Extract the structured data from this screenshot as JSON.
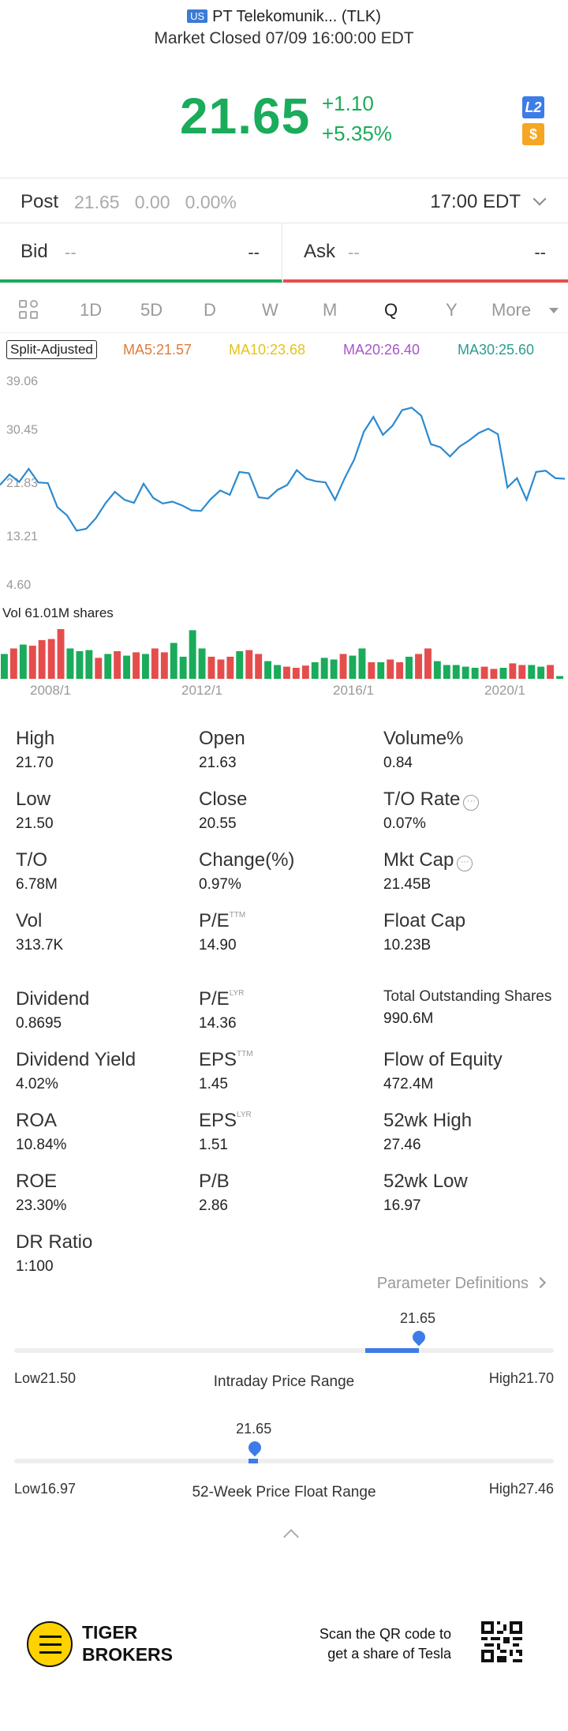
{
  "header": {
    "market_badge": "US",
    "title": "PT Telekomunik... (TLK)",
    "status": "Market Closed 07/09 16:00:00 EDT"
  },
  "quote": {
    "price": "21.65",
    "change": "+1.10",
    "change_pct": "+5.35%",
    "badge_l2": "L2",
    "badge_dollar": "$",
    "up_color": "#1aab5b"
  },
  "post": {
    "label": "Post",
    "values": "21.65   0.00   0.00%",
    "time": "17:00 EDT"
  },
  "bid": {
    "label": "Bid",
    "price": "--",
    "size": "--"
  },
  "ask": {
    "label": "Ask",
    "price": "--",
    "size": "--"
  },
  "tabs": [
    "1D",
    "5D",
    "D",
    "W",
    "M",
    "Q",
    "Y",
    "More"
  ],
  "active_tab": "Q",
  "ma": {
    "split": "Split-Adjusted",
    "ma5": "MA5:21.57",
    "ma10": "MA10:23.68",
    "ma20": "MA20:26.40",
    "ma30": "MA30:25.60"
  },
  "chart_data": {
    "type": "line",
    "y_ticks": [
      "39.06",
      "30.45",
      "21.83",
      "13.21",
      "4.60"
    ],
    "ylim": [
      4.6,
      39.06
    ],
    "x_labels": [
      "2008/1",
      "2012/1",
      "2016/1",
      "2020/1"
    ],
    "volume_label": "Vol",
    "volume_value": "61.01M shares",
    "series": [
      {
        "values": [
          21.4,
          23.1,
          21.9,
          24.0,
          21.8,
          21.7,
          17.8,
          16.5,
          14.0,
          14.3,
          16.0,
          18.4,
          20.3,
          19.0,
          18.5,
          21.6,
          19.3,
          18.4,
          18.7,
          18.1,
          17.3,
          17.2,
          19.1,
          20.5,
          19.8,
          23.5,
          23.3,
          19.4,
          19.2,
          20.6,
          21.4,
          23.8,
          22.4,
          22.0,
          21.8,
          19.0,
          22.5,
          25.5,
          30.0,
          32.4,
          29.5,
          31.0,
          33.5,
          33.9,
          32.6,
          28.0,
          27.5,
          26.0,
          27.6,
          28.6,
          29.8,
          30.5,
          29.6,
          21.0,
          22.5,
          19.0,
          23.5,
          23.7,
          22.5,
          22.4
        ]
      }
    ],
    "volume": [
      {
        "v": 0.45,
        "up": true
      },
      {
        "v": 0.55,
        "up": false
      },
      {
        "v": 0.62,
        "up": true
      },
      {
        "v": 0.6,
        "up": false
      },
      {
        "v": 0.7,
        "up": false
      },
      {
        "v": 0.72,
        "up": false
      },
      {
        "v": 0.9,
        "up": false
      },
      {
        "v": 0.55,
        "up": true
      },
      {
        "v": 0.5,
        "up": true
      },
      {
        "v": 0.52,
        "up": true
      },
      {
        "v": 0.38,
        "up": false
      },
      {
        "v": 0.45,
        "up": true
      },
      {
        "v": 0.5,
        "up": false
      },
      {
        "v": 0.42,
        "up": true
      },
      {
        "v": 0.48,
        "up": false
      },
      {
        "v": 0.45,
        "up": true
      },
      {
        "v": 0.55,
        "up": false
      },
      {
        "v": 0.48,
        "up": false
      },
      {
        "v": 0.65,
        "up": true
      },
      {
        "v": 0.4,
        "up": true
      },
      {
        "v": 0.88,
        "up": true
      },
      {
        "v": 0.55,
        "up": true
      },
      {
        "v": 0.4,
        "up": false
      },
      {
        "v": 0.35,
        "up": false
      },
      {
        "v": 0.4,
        "up": false
      },
      {
        "v": 0.5,
        "up": true
      },
      {
        "v": 0.52,
        "up": false
      },
      {
        "v": 0.45,
        "up": false
      },
      {
        "v": 0.32,
        "up": true
      },
      {
        "v": 0.25,
        "up": true
      },
      {
        "v": 0.22,
        "up": false
      },
      {
        "v": 0.2,
        "up": false
      },
      {
        "v": 0.24,
        "up": false
      },
      {
        "v": 0.3,
        "up": true
      },
      {
        "v": 0.38,
        "up": true
      },
      {
        "v": 0.35,
        "up": true
      },
      {
        "v": 0.45,
        "up": false
      },
      {
        "v": 0.42,
        "up": true
      },
      {
        "v": 0.55,
        "up": true
      },
      {
        "v": 0.3,
        "up": false
      },
      {
        "v": 0.3,
        "up": true
      },
      {
        "v": 0.35,
        "up": false
      },
      {
        "v": 0.3,
        "up": false
      },
      {
        "v": 0.4,
        "up": true
      },
      {
        "v": 0.45,
        "up": false
      },
      {
        "v": 0.55,
        "up": false
      },
      {
        "v": 0.32,
        "up": true
      },
      {
        "v": 0.25,
        "up": true
      },
      {
        "v": 0.25,
        "up": true
      },
      {
        "v": 0.22,
        "up": true
      },
      {
        "v": 0.2,
        "up": true
      },
      {
        "v": 0.22,
        "up": false
      },
      {
        "v": 0.18,
        "up": false
      },
      {
        "v": 0.2,
        "up": true
      },
      {
        "v": 0.28,
        "up": false
      },
      {
        "v": 0.25,
        "up": false
      },
      {
        "v": 0.25,
        "up": true
      },
      {
        "v": 0.22,
        "up": true
      },
      {
        "v": 0.25,
        "up": false
      },
      {
        "v": 0.05,
        "up": true
      }
    ]
  },
  "stats": [
    {
      "k": "High",
      "v": "21.70"
    },
    {
      "k": "Open",
      "v": "21.63"
    },
    {
      "k": "Volume%",
      "v": "0.84"
    },
    {
      "k": "Low",
      "v": "21.50"
    },
    {
      "k": "Close",
      "v": "20.55"
    },
    {
      "k": "T/O Rate",
      "v": "0.07%"
    },
    {
      "k": "T/O",
      "v": "6.78M"
    },
    {
      "k": "Change(%)",
      "v": "0.97%"
    },
    {
      "k": "Mkt Cap",
      "v": "21.45B"
    },
    {
      "k": "Vol",
      "v": "313.7K"
    },
    {
      "k": "P/E",
      "sup": "TTM",
      "v": "14.90"
    },
    {
      "k": "Float Cap",
      "v": "10.23B"
    },
    {
      "k": "Dividend",
      "v": "0.8695"
    },
    {
      "k": "P/E",
      "sup": "LYR",
      "v": "14.36"
    },
    {
      "k": "Total Outstanding Shares",
      "v": "990.6M"
    },
    {
      "k": "Dividend Yield",
      "v": "4.02%"
    },
    {
      "k": "EPS",
      "sup": "TTM",
      "v": "1.45"
    },
    {
      "k": "Flow of Equity",
      "v": "472.4M"
    },
    {
      "k": "ROA",
      "v": "10.84%"
    },
    {
      "k": "EPS",
      "sup": "LYR",
      "v": "1.51"
    },
    {
      "k": "52wk High",
      "v": "27.46"
    },
    {
      "k": "ROE",
      "v": "23.30%"
    },
    {
      "k": "P/B",
      "v": "2.86"
    },
    {
      "k": "52wk Low",
      "v": "16.97"
    },
    {
      "k": "DR Ratio",
      "v": "1:100"
    }
  ],
  "info_icon": "ⓘ",
  "param_def": "Parameter Definitions",
  "intraday": {
    "title": "Intraday Price Range",
    "price": "21.65",
    "low": "Low21.50",
    "high": "High21.70",
    "low_val": 21.5,
    "high_val": 21.7,
    "cur_val": 21.65,
    "open_val": 21.63
  },
  "week52": {
    "title": "52-Week Price Float Range",
    "price": "21.65",
    "low": "Low16.97",
    "high": "High27.46",
    "low_val": 16.97,
    "high_val": 27.46,
    "cur_val": 21.65,
    "open_val": 21.63
  },
  "footer": {
    "brand_line1": "TIGER",
    "brand_line2": "BROKERS",
    "scan_line1": "Scan the QR code to",
    "scan_line2": "get a share of Tesla"
  }
}
